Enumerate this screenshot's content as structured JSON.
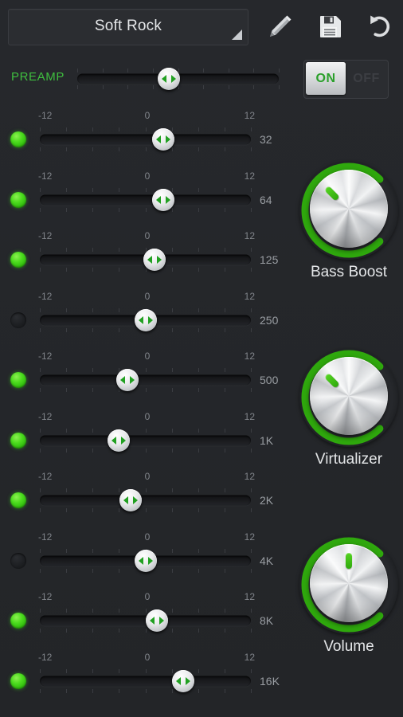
{
  "app": {
    "background_color": "#24262a",
    "accent_color": "#3fbf3f"
  },
  "toolbar": {
    "preset_name": "Soft Rock",
    "dropdown_caret_icon": "triangle-down-right-icon",
    "edit_label": "edit-preset",
    "edit_icon": "pencil-icon",
    "save_label": "save-preset",
    "save_icon": "floppy-disk-icon",
    "reset_label": "reset-preset",
    "reset_icon": "undo-arrow-icon"
  },
  "preamp": {
    "label": "PREAMP",
    "label_color": "#3fbf3f",
    "thumb_percent": 45.5
  },
  "power": {
    "on_label": "ON",
    "off_label": "OFF",
    "state": "ON",
    "on_text_color": "#2aa02a"
  },
  "scale": {
    "min": "-12",
    "mid": "0",
    "max": "12"
  },
  "bands": [
    {
      "freq": "32",
      "led": "on",
      "thumb_percent": 58.5
    },
    {
      "freq": "64",
      "led": "on",
      "thumb_percent": 58.5
    },
    {
      "freq": "125",
      "led": "on",
      "thumb_percent": 54.5
    },
    {
      "freq": "250",
      "led": "off",
      "thumb_percent": 50.0
    },
    {
      "freq": "500",
      "led": "on",
      "thumb_percent": 41.5
    },
    {
      "freq": "1K",
      "led": "on",
      "thumb_percent": 37.5
    },
    {
      "freq": "2K",
      "led": "on",
      "thumb_percent": 43.0
    },
    {
      "freq": "4K",
      "led": "off",
      "thumb_percent": 50.0
    },
    {
      "freq": "8K",
      "led": "on",
      "thumb_percent": 55.5
    },
    {
      "freq": "16K",
      "led": "on",
      "thumb_percent": 68.0
    }
  ],
  "knobs": [
    {
      "label": "Bass Boost",
      "angle_deg": -45,
      "arc_color": "#2fa80d"
    },
    {
      "label": "Virtualizer",
      "angle_deg": -45,
      "arc_color": "#2fa80d"
    },
    {
      "label": "Volume",
      "angle_deg": 0,
      "arc_color": "#2fa80d"
    }
  ]
}
